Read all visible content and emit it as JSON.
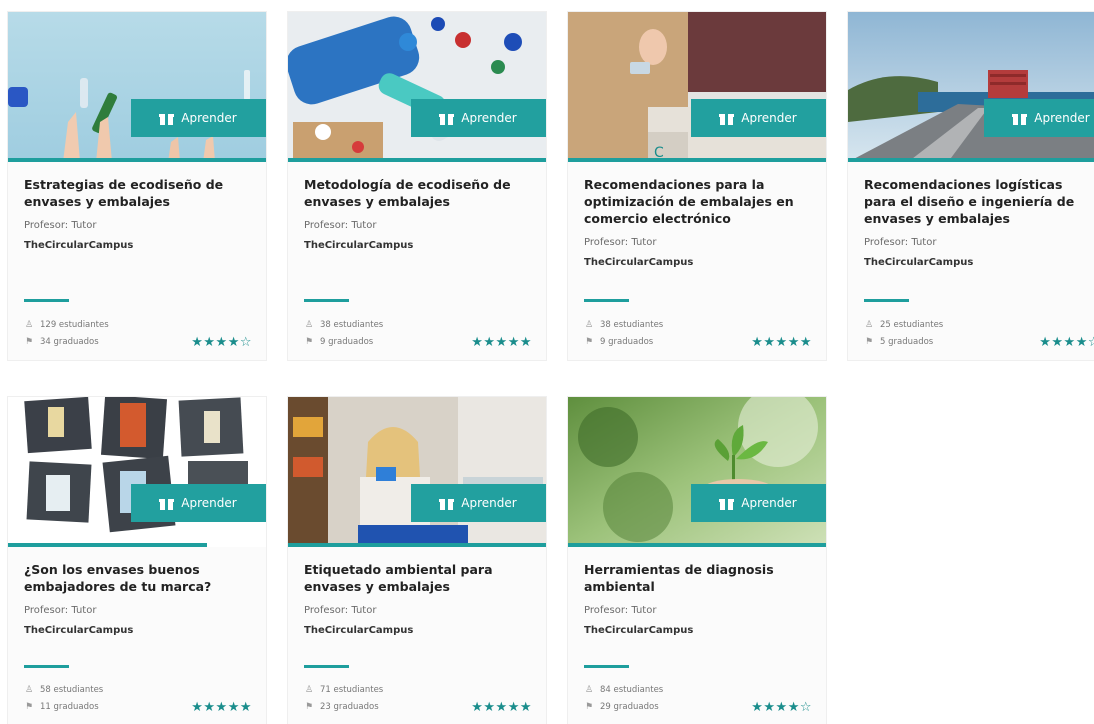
{
  "colors": {
    "accent": "#22a09f",
    "star": "#1a8d8c"
  },
  "courses": [
    {
      "title": "Estrategias de ecodiseño de envases y embalajes",
      "professor": "Profesor: Tutor",
      "org": "TheCircularCampus",
      "students": "129 estudiantes",
      "graduates": "34 graduados",
      "rating": 4,
      "button": "Aprender",
      "progress": 1.0
    },
    {
      "title": "Metodología de ecodiseño de envases y embalajes",
      "professor": "Profesor: Tutor",
      "org": "TheCircularCampus",
      "students": "38 estudiantes",
      "graduates": "9 graduados",
      "rating": 5,
      "button": "Aprender",
      "progress": 1.0
    },
    {
      "title": "Recomendaciones para la optimización de embalajes en comercio electrónico",
      "professor": "Profesor: Tutor",
      "org": "TheCircularCampus",
      "students": "38 estudiantes",
      "graduates": "9 graduados",
      "rating": 5,
      "button": "Aprender",
      "progress": 1.0
    },
    {
      "title": "Recomendaciones logísticas para el diseño e ingeniería de envases y embalajes",
      "professor": "Profesor: Tutor",
      "org": "TheCircularCampus",
      "students": "25 estudiantes",
      "graduates": "5 graduados",
      "rating": 4,
      "button": "Aprender",
      "progress": 1.0
    },
    {
      "title": "¿Son los envases buenos embajadores de tu marca?",
      "professor": "Profesor: Tutor",
      "org": "TheCircularCampus",
      "students": "58 estudiantes",
      "graduates": "11 graduados",
      "rating": 5,
      "button": "Aprender",
      "progress": 0.77
    },
    {
      "title": "Etiquetado ambiental para envases y embalajes",
      "professor": "Profesor: Tutor",
      "org": "TheCircularCampus",
      "students": "71 estudiantes",
      "graduates": "23 graduados",
      "rating": 5,
      "button": "Aprender",
      "progress": 1.0
    },
    {
      "title": "Herramientas de diagnosis ambiental",
      "professor": "Profesor: Tutor",
      "org": "TheCircularCampus",
      "students": "84 estudiantes",
      "graduates": "29 graduados",
      "rating": 4,
      "button": "Aprender",
      "progress": 1.0
    }
  ]
}
